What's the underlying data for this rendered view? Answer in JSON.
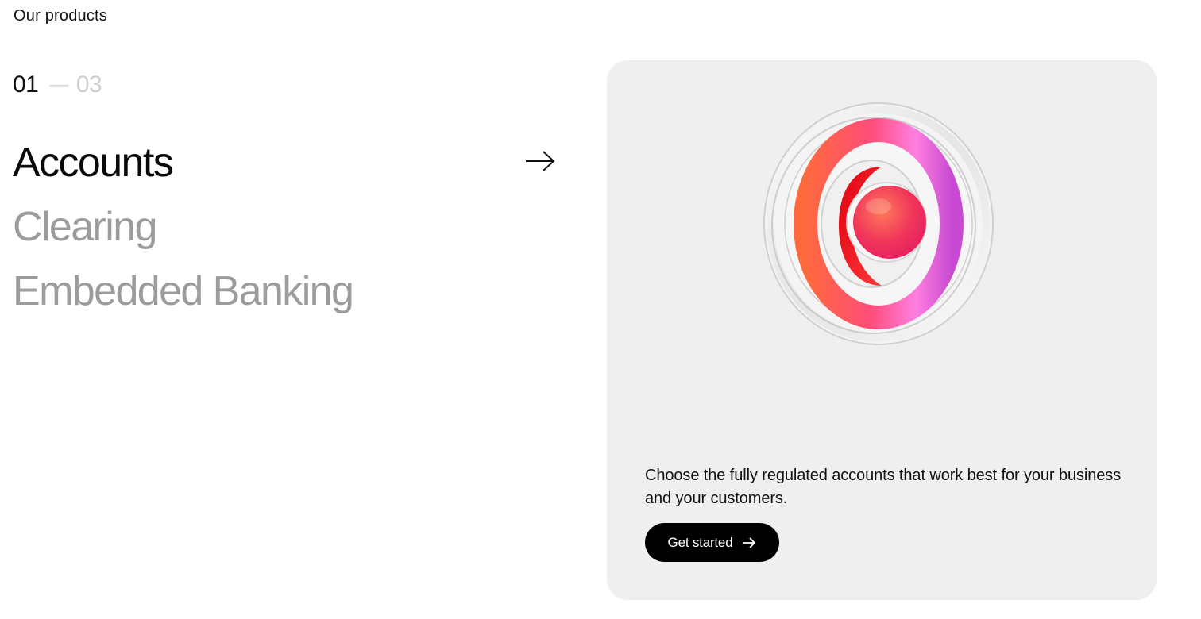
{
  "section": {
    "label": "Our products"
  },
  "counter": {
    "current": "01",
    "separator": "—",
    "total": "03"
  },
  "products": [
    {
      "label": "Accounts",
      "active": true,
      "icon": "arrow-right-icon"
    },
    {
      "label": "Clearing",
      "active": false
    },
    {
      "label": "Embedded Banking",
      "active": false
    }
  ],
  "card": {
    "image": "glossy-ring-sphere-illustration",
    "description": "Choose the fully regulated accounts that work best for your business and your customers.",
    "cta_label": "Get started",
    "cta_icon": "arrow-right-icon"
  },
  "colors": {
    "active_text": "#0a0a0a",
    "inactive_text": "#9c9c9c",
    "card_bg": "#efefef",
    "button_bg": "#000000",
    "button_text": "#ffffff"
  }
}
